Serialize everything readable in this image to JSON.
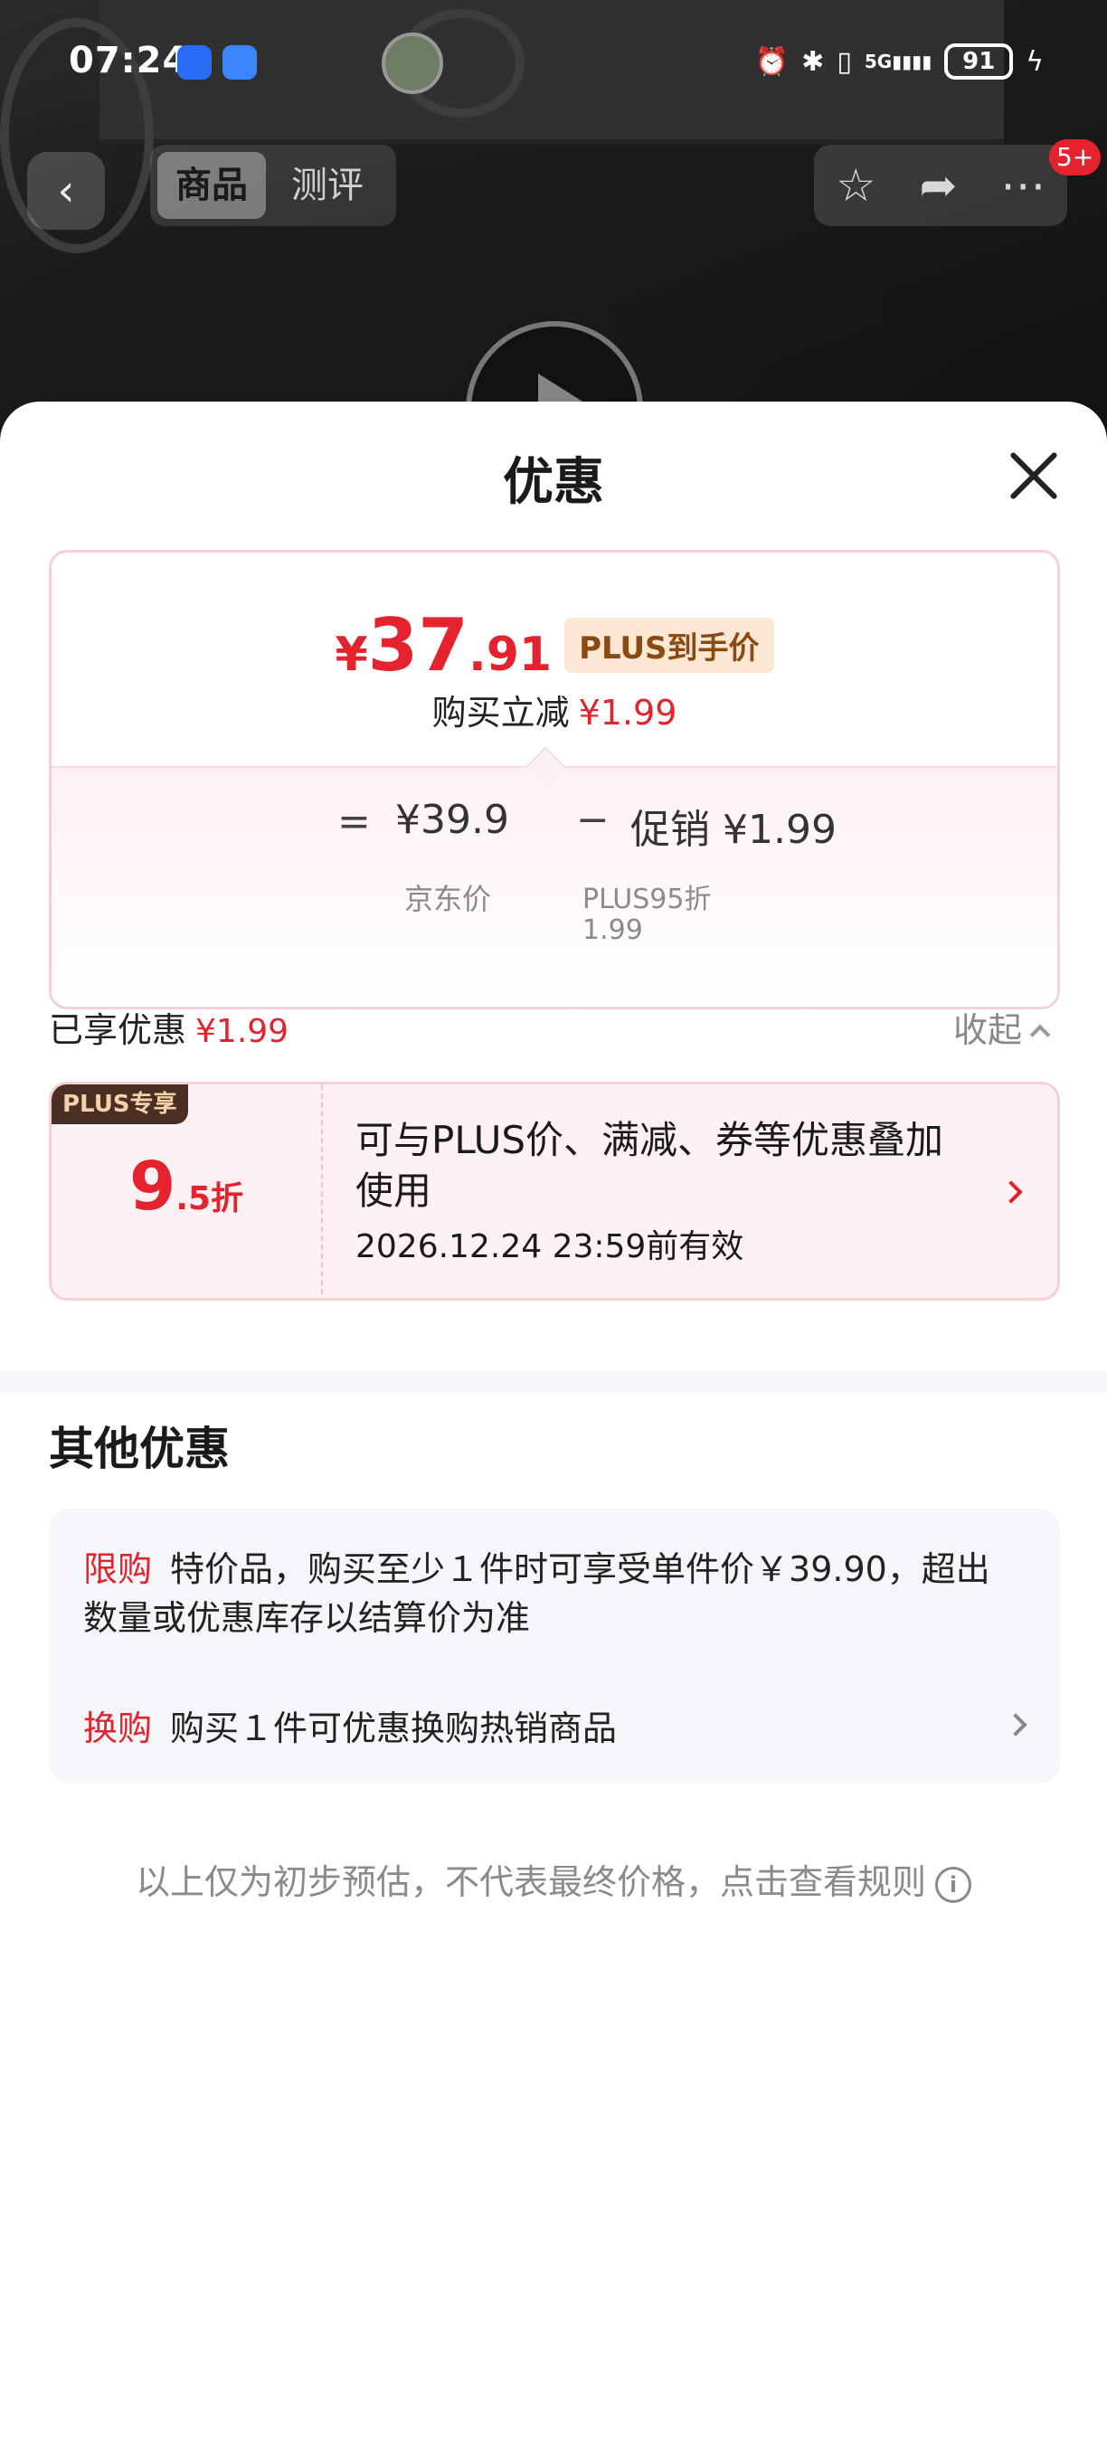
{
  "status_bar": {
    "time": "07:24",
    "battery": "91",
    "network": "5G"
  },
  "header": {
    "tabs": [
      "商品",
      "测评"
    ],
    "badge": "5+"
  },
  "sheet": {
    "title": "优惠",
    "price": {
      "yen": "¥",
      "int": "37",
      "dec": ".91",
      "plus_tag": "PLUS到手价",
      "reduce_label": "购买立减",
      "reduce_amount": "¥1.99",
      "equals": "=",
      "jd_price": "¥39.9",
      "jd_price_label": "京东价",
      "minus": "−",
      "promo": "促销 ¥1.99",
      "promo_sub": "PLUS95折",
      "promo_sub_amount": "1.99"
    },
    "enjoyed": {
      "label": "已享优惠",
      "amount": "¥1.99",
      "collapse": "收起"
    },
    "coupon": {
      "tag": "PLUS专享",
      "discount_big": "9",
      "discount_small": ".5折",
      "description": "可与PLUS价、满减、券等优惠叠加使用",
      "valid": "2026.12.24 23:59前有效"
    },
    "other": {
      "title": "其他优惠",
      "items": [
        {
          "label": "限购",
          "text": "特价品，购买至少１件时可享受单件价￥39.90，超出数量或优惠库存以结算价为准"
        },
        {
          "label": "换购",
          "text": "购买１件可优惠换购热销商品"
        }
      ]
    },
    "footnote": "以上仅为初步预估，不代表最终价格，点击查看规则"
  },
  "colors": {
    "accent_red": "#e4232f",
    "plus_tag_bg": "#fbe7d3",
    "coupon_bg": "#fdf1f3"
  },
  "icons": [
    "shield-icon",
    "message-icon",
    "alarm-icon",
    "bluetooth-icon",
    "vibrate-icon",
    "signal-icon",
    "battery-icon",
    "back-icon",
    "star-icon",
    "share-icon",
    "more-icon",
    "play-icon",
    "close-icon",
    "chevron-up-icon",
    "chevron-right-icon",
    "info-icon"
  ]
}
